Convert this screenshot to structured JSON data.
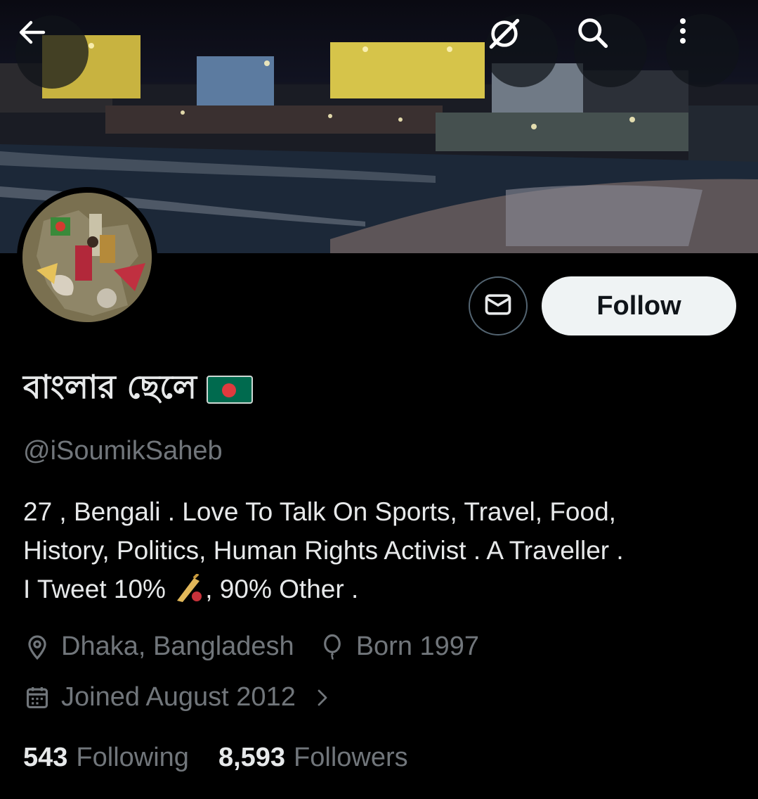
{
  "nav": {
    "back_icon": "arrow-left-icon",
    "satellite_icon": "satellite-off-icon",
    "search_icon": "search-icon",
    "more_icon": "more-vertical-icon"
  },
  "profile": {
    "display_name": "বাংলার ছেলে",
    "flag_icon": "bangladesh-flag-icon",
    "handle": "@iSoumikSaheb",
    "bio_lines": [
      "27 , Bengali . Love To Talk On Sports, Travel, Food,",
      "History, Politics, Human Rights Activist . A Traveller .",
      "I Tweet 10%",
      ", 90% Other ."
    ],
    "bio_emoji": "cricket-bat-icon",
    "location": "Dhaka, Bangladesh",
    "birth": "Born 1997",
    "joined": "Joined August 2012",
    "following_count": "543",
    "following_label": "Following",
    "followers_count": "8,593",
    "followers_label": "Followers"
  },
  "actions": {
    "message_icon": "envelope-icon",
    "follow_label": "Follow"
  },
  "colors": {
    "background": "#000000",
    "primary_text": "#e7e9ea",
    "secondary_text": "#71767b",
    "follow_bg": "#eff3f4",
    "flag_green": "#006a4e",
    "flag_red": "#e03a3e"
  }
}
